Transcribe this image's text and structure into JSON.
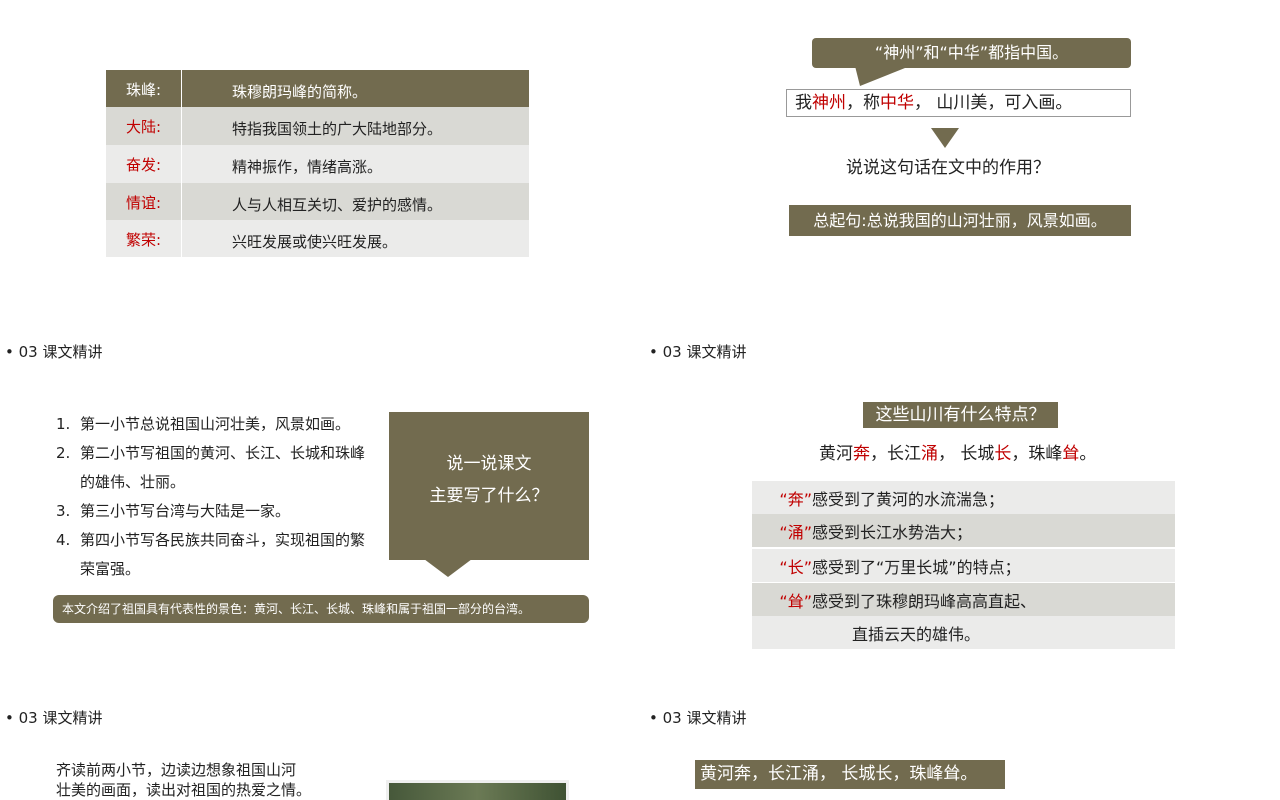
{
  "vocab": [
    {
      "term": "珠峰:",
      "definition": "珠穆朗玛峰的简称。"
    },
    {
      "term": "大陆:",
      "definition": "特指我国领土的广大陆地部分。"
    },
    {
      "term": "奋发:",
      "definition": "精神振作，情绪高涨。"
    },
    {
      "term": "情谊:",
      "definition": "人与人相互关切、爱护的感情。"
    },
    {
      "term": "繁荣:",
      "definition": "兴旺发展或使兴旺发展。"
    }
  ],
  "slide2": {
    "callout": "“神州”和“中华”都指中国。",
    "sentence": {
      "p1": "我",
      "r1": "神州",
      "p2": "，称",
      "r2": "中华",
      "p3": "，  山川美，可入画。"
    },
    "question": "说说这句话在文中的作用？",
    "answer": "总起句:总说我国的山河壮丽，风景如画。"
  },
  "section_header": "03  课文精讲",
  "bullet": "•",
  "slide3": {
    "items": [
      {
        "n": "1.",
        "text": "第一小节总说祖国山河壮美，风景如画。"
      },
      {
        "n": "2.",
        "text": "第二小节写祖国的黄河、长江、长城和珠峰的雄伟、壮丽。"
      },
      {
        "n": "3.",
        "text": "第三小节写台湾与大陆是一家。"
      },
      {
        "n": "4.",
        "text": "第四小节写各民族共同奋斗，实现祖国的繁荣富强。"
      }
    ],
    "callout_line1": "说一说课文",
    "callout_line2": "主要写了什么？",
    "summary": "本文介绍了祖国具有代表性的景色：黄河、长江、长城、珠峰和属于祖国一部分的台湾。"
  },
  "slide4": {
    "question": "这些山川有什么特点？",
    "phrase": {
      "a1": "黄河",
      "a2": "奔",
      "b1": "，长江",
      "b2": "涌",
      "c1": "，  长城",
      "c2": "长",
      "d1": "，珠峰",
      "d2": "耸",
      "e": "。"
    },
    "rows": [
      {
        "q": "“奔”",
        "text": "感受到了黄河的水流湍急；"
      },
      {
        "q": "“涌”",
        "text": "感受到长江水势浩大；"
      },
      {
        "q": "“长”",
        "text": "感受到了“万里长城”的特点；"
      },
      {
        "q": "“耸”",
        "text": "感受到了珠穆朗玛峰高高直起、"
      },
      {
        "q": "",
        "text": "直插云天的雄伟。"
      }
    ]
  },
  "slide5": {
    "instruction_line1": "齐读前两小节，边读边想象祖国山河",
    "instruction_line2": "壮美的画面，读出对祖国的热爱之情。"
  },
  "slide6": {
    "banner": "黄河奔，长江涌，  长城长，珠峰耸。"
  },
  "colors": {
    "olive": "#726b4f",
    "gray_row": "#d9d9d4",
    "light_row": "#ebebea",
    "accent_red": "#c00000"
  }
}
